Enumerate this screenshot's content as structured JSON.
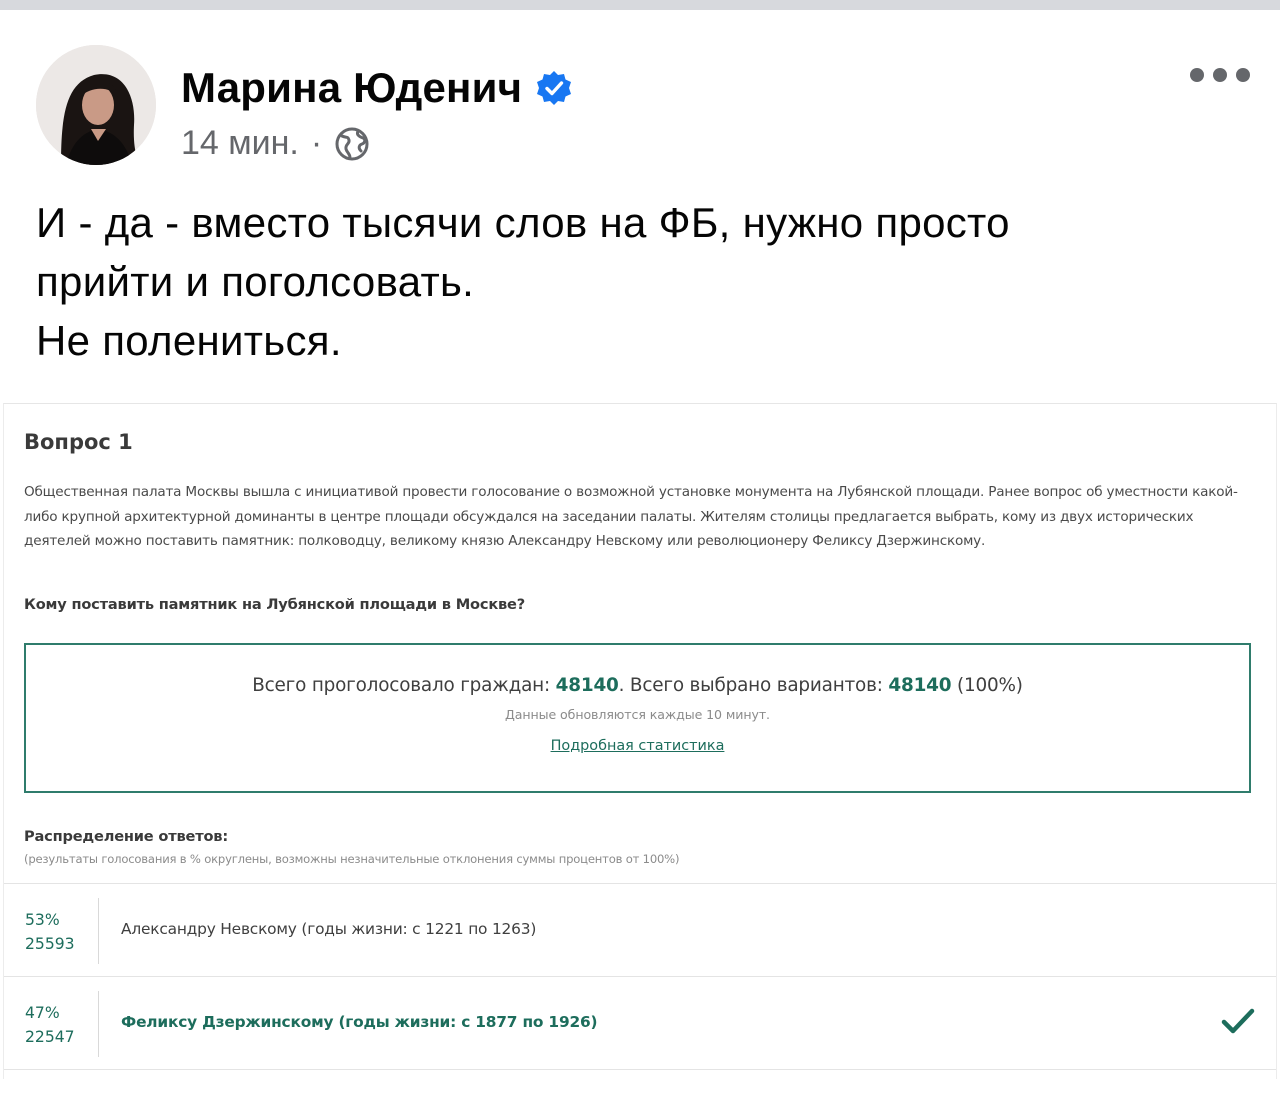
{
  "post": {
    "author": "Марина Юденич",
    "time": "14 мин.",
    "separator": "·",
    "text_lines": [
      "И - да - вместо тысячи слов на ФБ, нужно просто",
      "прийти и поголсовать.",
      "Не полениться."
    ]
  },
  "poll": {
    "title": "Вопрос 1",
    "description": "Общественная палата Москвы вышла с инициативой провести голосование о возможной установке монумента на Лубянской площади. Ранее вопрос об уместности какой-либо крупной архитектурной доминанты в центре площади обсуждался на заседании палаты. Жителям столицы предлагается выбрать, кому из двух исторических деятелей можно поставить памятник: полководцу, великому князю Александру Невскому или революционеру Феликсу Дзержинскому.",
    "question": "Кому поставить памятник на Лубянской площади в Москве?",
    "stats": {
      "voted_label": "Всего проголосовало граждан:",
      "voted_value": "48140",
      "chosen_label": ". Всего выбрано вариантов:",
      "chosen_value": "48140",
      "chosen_pct": "(100%)",
      "note": "Данные обновляются каждые 10 минут.",
      "link": "Подробная статистика"
    },
    "distribution_title": "Распределение ответов:",
    "distribution_note": "(результаты голосования в % округлены, возможны незначительные отклонения суммы процентов от 100%)",
    "answers": [
      {
        "percent": "53%",
        "votes": "25593",
        "label": "Александру Невскому (годы жизни: с 1221 по 1263)"
      },
      {
        "percent": "47%",
        "votes": "22547",
        "label": "Феликсу Дзержинскому (годы жизни: с 1877 по 1926)"
      }
    ]
  },
  "icons": {
    "verified": "verified-badge-icon",
    "audience": "globe-icon",
    "more": "more-options-icon",
    "selected": "checkmark-icon"
  },
  "colors": {
    "verified_blue": "#1877f2",
    "poll_accent": "#1d6d5c",
    "meta_gray": "#65676b"
  }
}
